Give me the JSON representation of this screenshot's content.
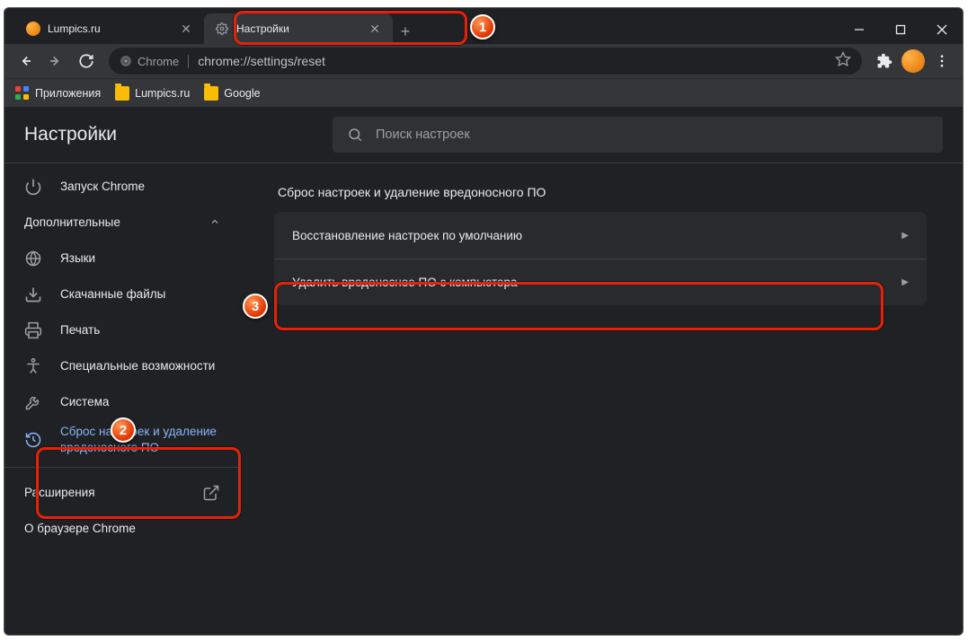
{
  "tabs": [
    {
      "title": "Lumpics.ru"
    },
    {
      "title": "Настройки"
    }
  ],
  "toolbar": {
    "chrome_label": "Chrome",
    "url": "chrome://settings/reset"
  },
  "bookmarks": {
    "apps": "Приложения",
    "items": [
      "Lumpics.ru",
      "Google"
    ]
  },
  "settings": {
    "title": "Настройки",
    "search_placeholder": "Поиск настроек"
  },
  "sidebar": {
    "startup": "Запуск Chrome",
    "advanced": "Дополнительные",
    "languages": "Языки",
    "downloads": "Скачанные файлы",
    "print": "Печать",
    "accessibility": "Специальные возможности",
    "system": "Система",
    "reset": "Сброс настроек и удаление вредоносного ПО",
    "extensions": "Расширения",
    "about": "О браузере Chrome"
  },
  "content": {
    "section_title": "Сброс настроек и удаление вредоносного ПО",
    "row1": "Восстановление настроек по умолчанию",
    "row2": "Удалить вредоносное ПО с компьютера"
  },
  "badges": {
    "b1": "1",
    "b2": "2",
    "b3": "3"
  }
}
